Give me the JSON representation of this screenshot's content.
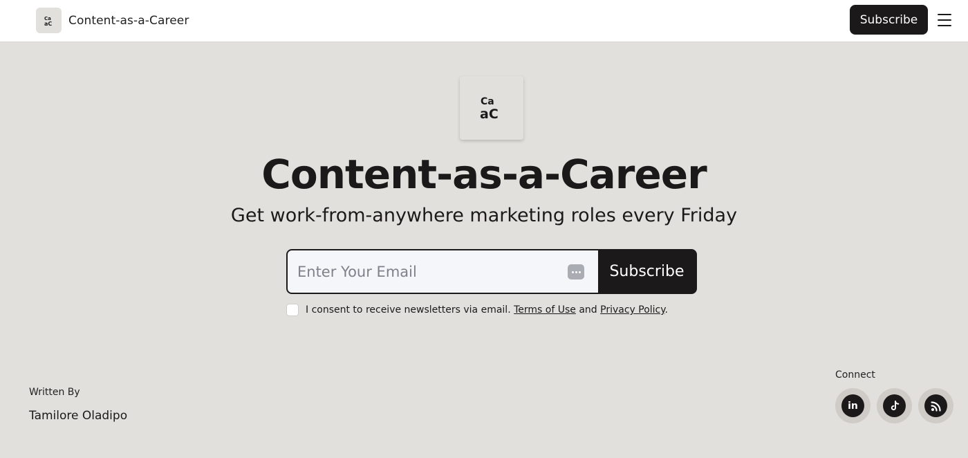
{
  "header": {
    "brand_name": "Content-as-a-Career",
    "subscribe_label": "Subscribe"
  },
  "hero": {
    "title": "Content-as-a-Career",
    "subtitle": "Get work-from-anywhere marketing roles every Friday"
  },
  "form": {
    "email_placeholder": "Enter Your Email",
    "email_value": "",
    "subscribe_label": "Subscribe",
    "consent_text": "I consent to receive newsletters via email.",
    "terms_label": "Terms of Use",
    "and_text": "and",
    "privacy_label": "Privacy Policy",
    "period": ".",
    "consent_checked": false
  },
  "footer": {
    "written_by_label": "Written By",
    "author": "Tamilore Oladipo",
    "connect_label": "Connect",
    "social": [
      {
        "icon": "linkedin-icon",
        "glyph": "in"
      },
      {
        "icon": "tiktok-icon",
        "glyph": "♪"
      },
      {
        "icon": "rss-icon",
        "glyph": ""
      }
    ]
  },
  "colors": {
    "background": "#e2e0dc",
    "dark": "#1b1919",
    "header_bg": "#ffffff",
    "input_bg": "#f4f6fa"
  }
}
